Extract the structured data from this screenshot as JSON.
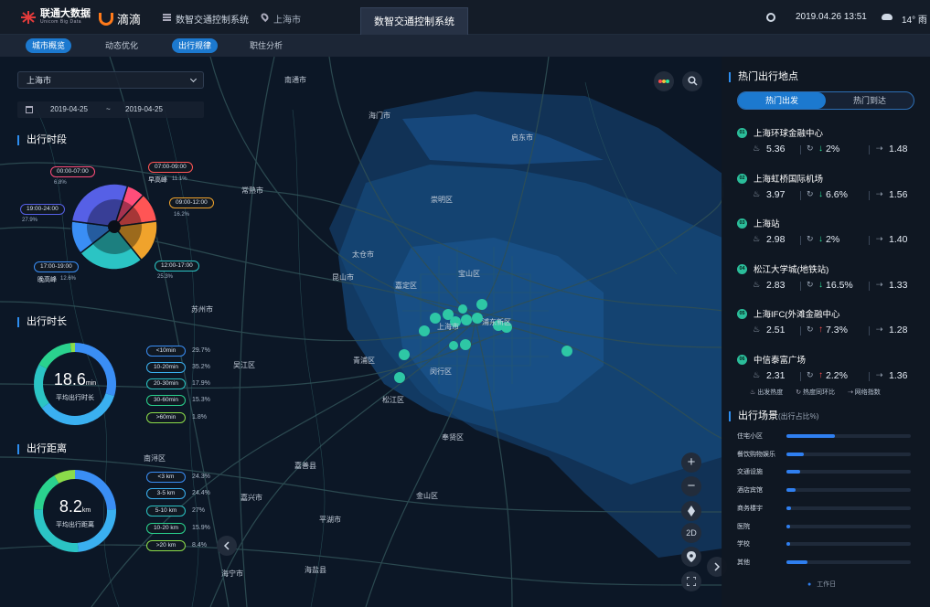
{
  "header": {
    "unicom_name": "联通大数据",
    "unicom_sub": "Unicom Big Data",
    "didi": "滴滴",
    "system_name": "数智交通控制系统",
    "city": "上海市",
    "active_tab": "数智交通控制系统",
    "datetime": "2019.04.26 13:51",
    "weather": "14° 雨"
  },
  "nav": {
    "tabs": [
      "城市概览",
      "动态优化",
      "出行规律",
      "职住分析"
    ],
    "active": [
      "城市概览",
      "出行规律"
    ]
  },
  "filters": {
    "city_select": "上海市",
    "date_from": "2019-04-25",
    "date_sep": "~",
    "date_to": "2019-04-25"
  },
  "time_section": {
    "title": "出行时段",
    "slots": [
      {
        "range": "00:00-07:00",
        "pct": "6.8%",
        "color": "#ff4d7a"
      },
      {
        "range": "07:00-09:00",
        "name": "早高峰",
        "pct": "11.1%",
        "color": "#ff5555"
      },
      {
        "range": "09:00-12:00",
        "pct": "16.2%",
        "color": "#f0a32c"
      },
      {
        "range": "12:00-17:00",
        "pct": "25.3%",
        "color": "#2bc4c4"
      },
      {
        "range": "17:00-19:00",
        "name": "晚高峰",
        "pct": "12.6%",
        "color": "#3a8ef5"
      },
      {
        "range": "19:00-24:00",
        "pct": "27.9%",
        "color": "#5660e6"
      }
    ]
  },
  "duration_section": {
    "title": "出行时长",
    "center_value": "18.6",
    "center_unit": "min",
    "center_label": "平均出行时长",
    "rows": [
      {
        "label": "<10min",
        "pct": "29.7%",
        "color": "#3a8ef5"
      },
      {
        "label": "10-20min",
        "pct": "35.2%",
        "color": "#3ab0f0"
      },
      {
        "label": "20-30min",
        "pct": "17.9%",
        "color": "#2bc4c4"
      },
      {
        "label": "30-60min",
        "pct": "15.3%",
        "color": "#2ad28e"
      },
      {
        "label": ">60min",
        "pct": "1.8%",
        "color": "#8bdc4a"
      }
    ]
  },
  "distance_section": {
    "title": "出行距离",
    "center_value": "8.2",
    "center_unit": "km",
    "center_label": "平均出行距离",
    "rows": [
      {
        "label": "<3 km",
        "pct": "24.3%",
        "color": "#3a8ef5"
      },
      {
        "label": "3-5 km",
        "pct": "24.4%",
        "color": "#3ab0f0"
      },
      {
        "label": "5-10 km",
        "pct": "27%",
        "color": "#2bc4c4"
      },
      {
        "label": "10-20 km",
        "pct": "15.9%",
        "color": "#2ad28e"
      },
      {
        "label": ">20 km",
        "pct": "8.4%",
        "color": "#8bdc4a"
      }
    ]
  },
  "map_labels": [
    "南通市",
    "海门市",
    "启东市",
    "崇明区",
    "常熟市",
    "太仓市",
    "昆山市",
    "宝山区",
    "嘉定区",
    "苏州市",
    "青浦区",
    "上海市",
    "浦东新区",
    "闵行区",
    "吴江区",
    "松江区",
    "奉贤区",
    "嘉善县",
    "嘉兴市",
    "金山区",
    "平湖市",
    "海盐县",
    "海宁市",
    "南浔区"
  ],
  "map_controls": {
    "zoom_in": "+",
    "zoom_out": "−",
    "mode": "2D"
  },
  "hot_section": {
    "title": "热门出行地点",
    "tab_departure": "热门出发",
    "tab_arrival": "热门到达",
    "places": [
      {
        "rank": "01",
        "name": "上海环球金融中心",
        "heat": "5.36",
        "trend": "down",
        "change": "2%",
        "ratio": "1.48"
      },
      {
        "rank": "02",
        "name": "上海虹桥国际机场",
        "heat": "3.97",
        "trend": "down",
        "change": "6.6%",
        "ratio": "1.56"
      },
      {
        "rank": "03",
        "name": "上海站",
        "heat": "2.98",
        "trend": "down",
        "change": "2%",
        "ratio": "1.40"
      },
      {
        "rank": "04",
        "name": "松江大学城(地铁站)",
        "heat": "2.83",
        "trend": "down",
        "change": "16.5%",
        "ratio": "1.33"
      },
      {
        "rank": "05",
        "name": "上海IFC(外滩金融中心",
        "heat": "2.51",
        "trend": "up",
        "change": "7.3%",
        "ratio": "1.28"
      },
      {
        "rank": "06",
        "name": "中信泰富广场",
        "heat": "2.31",
        "trend": "up",
        "change": "2.2%",
        "ratio": "1.36"
      }
    ],
    "legend": [
      "出发热度",
      "热度同环比",
      "网络指数"
    ]
  },
  "scene_section": {
    "title": "出行场景",
    "subtitle": "(出行占比%)",
    "rows": [
      {
        "label": "住宅小区",
        "value": 0.39
      },
      {
        "label": "餐饮购物娱乐",
        "value": 0.14
      },
      {
        "label": "交通设施",
        "value": 0.11
      },
      {
        "label": "酒店宾馆",
        "value": 0.07
      },
      {
        "label": "商务楼宇",
        "value": 0.04
      },
      {
        "label": "医院",
        "value": 0.03
      },
      {
        "label": "学校",
        "value": 0.03
      },
      {
        "label": "其他",
        "value": 0.17
      }
    ],
    "legend": "工作日"
  },
  "colors": {
    "accent": "#1c79cf",
    "panel": "#0f1722",
    "up": "#ff4f4f",
    "down": "#2ee59d"
  }
}
